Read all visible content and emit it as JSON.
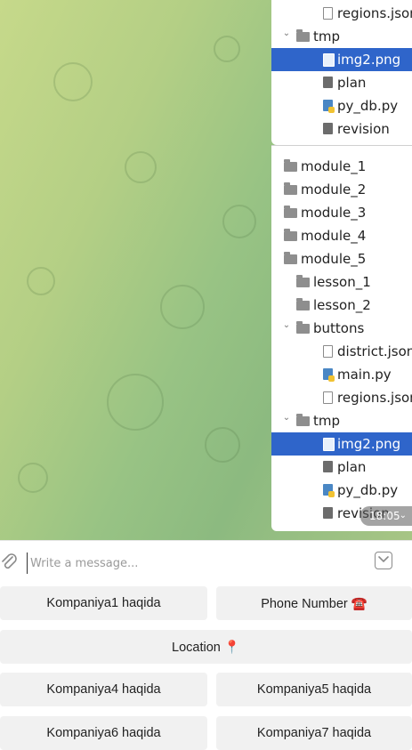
{
  "tree_top": [
    {
      "label": "regions.json",
      "kind": "json",
      "indent": 3,
      "arrow": ""
    },
    {
      "label": "tmp",
      "kind": "dir",
      "indent": 1,
      "arrow": "open"
    },
    {
      "label": "img2.png",
      "kind": "img",
      "indent": 3,
      "arrow": "",
      "selected": true
    },
    {
      "label": "plan",
      "kind": "doc",
      "indent": 3,
      "arrow": ""
    },
    {
      "label": "py_db.py",
      "kind": "py",
      "indent": 3,
      "arrow": ""
    },
    {
      "label": "revision",
      "kind": "doc",
      "indent": 3,
      "arrow": ""
    }
  ],
  "tree_bottom": [
    {
      "label": "module_1",
      "kind": "dir",
      "indent": 0,
      "arrow": ""
    },
    {
      "label": "module_2",
      "kind": "dir",
      "indent": 0,
      "arrow": ""
    },
    {
      "label": "module_3",
      "kind": "dir",
      "indent": 0,
      "arrow": ""
    },
    {
      "label": "module_4",
      "kind": "dir",
      "indent": 0,
      "arrow": ""
    },
    {
      "label": "module_5",
      "kind": "dir",
      "indent": 0,
      "arrow": ""
    },
    {
      "label": "lesson_1",
      "kind": "dir",
      "indent": 1,
      "arrow": ""
    },
    {
      "label": "lesson_2",
      "kind": "dir",
      "indent": 1,
      "arrow": ""
    },
    {
      "label": "buttons",
      "kind": "dir",
      "indent": 1,
      "arrow": "open"
    },
    {
      "label": "district.json",
      "kind": "json",
      "indent": 3,
      "arrow": ""
    },
    {
      "label": "main.py",
      "kind": "py",
      "indent": 3,
      "arrow": ""
    },
    {
      "label": "regions.json",
      "kind": "json",
      "indent": 3,
      "arrow": ""
    },
    {
      "label": "tmp",
      "kind": "dir",
      "indent": 1,
      "arrow": "open"
    },
    {
      "label": "img2.png",
      "kind": "img",
      "indent": 3,
      "arrow": "",
      "selected": true
    },
    {
      "label": "plan",
      "kind": "doc",
      "indent": 3,
      "arrow": ""
    },
    {
      "label": "py_db.py",
      "kind": "py",
      "indent": 3,
      "arrow": ""
    },
    {
      "label": "revision",
      "kind": "doc",
      "indent": 3,
      "arrow": ""
    }
  ],
  "message": {
    "time": "18:05"
  },
  "composer": {
    "placeholder": "Write a message..."
  },
  "keyboard": {
    "btn1": "Kompaniya1 haqida",
    "btn_phone": "Phone Number ☎️",
    "btn_location": "Location 📍",
    "btn4": "Kompaniya4 haqida",
    "btn5": "Kompaniya5 haqida",
    "btn6": "Kompaniya6 haqida",
    "btn7": "Kompaniya7 haqida"
  },
  "colors": {
    "selection": "#2f65ca",
    "button_bg": "#f1f1f1",
    "wallpaper_light": "#c6d98a",
    "wallpaper_dark": "#8cba80"
  },
  "icons": [
    "paperclip-icon",
    "keyboard-toggle-icon",
    "folder-icon",
    "file-icon",
    "python-file-icon",
    "json-file-icon",
    "image-file-icon",
    "chevron-down-icon"
  ]
}
